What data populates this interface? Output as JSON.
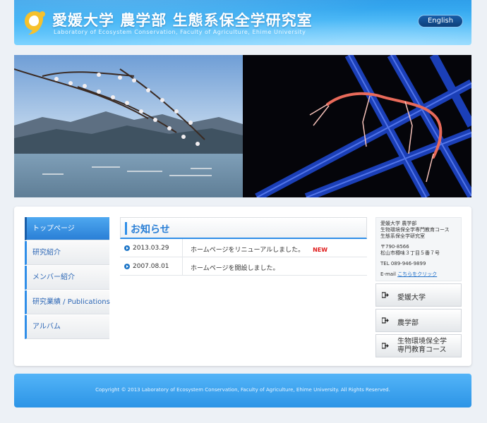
{
  "header": {
    "title": "愛媛大学 農学部 生態系保全学研究室",
    "subtitle": "Laboratory of Ecosystem Conservation, Faculty of Agriculture, Ehime University",
    "english_label": "English"
  },
  "sidebar": {
    "items": [
      {
        "label": "トップページ"
      },
      {
        "label": "研究紹介"
      },
      {
        "label": "メンバー紹介"
      },
      {
        "label": "研究業績 / Publications"
      },
      {
        "label": "アルバム"
      }
    ]
  },
  "news": {
    "title": "お知らせ",
    "items": [
      {
        "date": "2013.03.29",
        "text": "ホームページをリニューアルしました。",
        "badge": "NEW"
      },
      {
        "date": "2007.08.01",
        "text": "ホームページを開設しました。"
      }
    ]
  },
  "contact": {
    "org_line1": "愛媛大学 農学部",
    "org_line2": "生物環境保全学専門教育コース",
    "org_line3": "生態系保全学研究室",
    "postal": "〒790-8566",
    "address": "松山市樽味３丁目５番７号",
    "tel": "TEL 089-946-9899",
    "email_label": "E-mail",
    "email_link": "こちらをクリック"
  },
  "links": [
    {
      "label": "愛媛大学"
    },
    {
      "label": "農学部"
    },
    {
      "label_line1": "生物環境保全学",
      "label_line2": "専門教育コース"
    }
  ],
  "footer": {
    "copyright": "Copyright © 2013 Laboratory of Ecosystem Conservation, Faculty of Agriculture, Ehime University. All Rights Reserved."
  },
  "colors": {
    "accent": "#2f8ee8",
    "header_blue": "#3cb2f5",
    "new_badge": "#e01b1b"
  }
}
